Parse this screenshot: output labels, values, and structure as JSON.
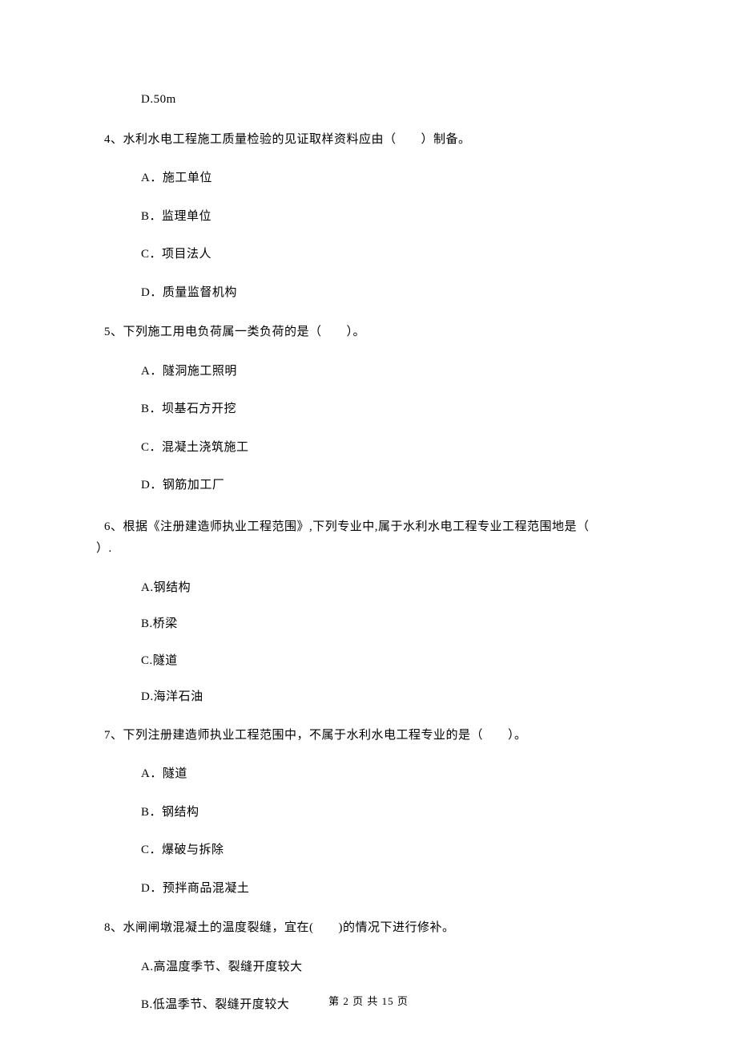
{
  "prev_option": "D.50m",
  "q4": {
    "stem": "4、水利水电工程施工质量检验的见证取样资料应由（　　）制备。",
    "options": {
      "a": "A．施工单位",
      "b": "B．监理单位",
      "c": "C．项目法人",
      "d": "D．质量监督机构"
    }
  },
  "q5": {
    "stem": "5、下列施工用电负荷属一类负荷的是（　　）。",
    "options": {
      "a": "A．隧洞施工照明",
      "b": "B．坝基石方开挖",
      "c": "C．混凝土浇筑施工",
      "d": "D．钢筋加工厂"
    }
  },
  "q6": {
    "stem_line1": "6、根据《注册建造师执业工程范围》,下列专业中,属于水利水电工程专业工程范围地是（　",
    "stem_line2": "）.",
    "options": {
      "a": "A.钢结构",
      "b": "B.桥梁",
      "c": "C.隧道",
      "d": "D.海洋石油"
    }
  },
  "q7": {
    "stem": "7、下列注册建造师执业工程范围中，不属于水利水电工程专业的是（　　）。",
    "options": {
      "a": "A．隧道",
      "b": "B．钢结构",
      "c": "C．爆破与拆除",
      "d": "D．预拌商品混凝土"
    }
  },
  "q8": {
    "stem": "8、水闸闸墩混凝土的温度裂缝，宜在(　　)的情况下进行修补。",
    "options": {
      "a": "A.高温度季节、裂缝开度较大",
      "b": "B.低温季节、裂缝开度较大"
    }
  },
  "footer": "第 2 页 共 15 页"
}
